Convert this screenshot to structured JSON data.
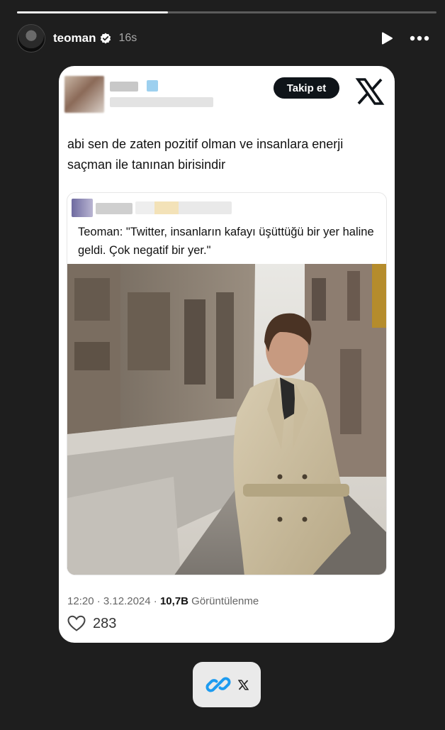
{
  "story": {
    "progress": 0.36,
    "username": "teoman",
    "time_ago": "16s",
    "icons": {
      "avatar": "profile-avatar",
      "verified": "verified-badge-icon",
      "play": "play-icon",
      "more": "more-horizontal-icon"
    }
  },
  "tweet": {
    "follow_label": "Takip et",
    "platform_icon": "x-logo-icon",
    "text": "abi sen de zaten pozitif olman ve insanlara enerji saçman ile tanınan birisindir",
    "quote": {
      "text": "Teoman: \"Twitter, insanların kafayı üşüttüğü bir yer haline geldi. Çok negatif bir yer.\"",
      "image": "man-in-beige-trench-coat-on-street"
    },
    "time": "12:20",
    "date": "3.12.2024",
    "separator": "·",
    "views_count": "10,7B",
    "views_label": "Görüntülenme",
    "likes": "283",
    "like_icon": "heart-icon"
  },
  "link_sticker": {
    "icon": "link-icon",
    "site_icon": "x-logo-icon",
    "accent": "#1d9bf0"
  }
}
